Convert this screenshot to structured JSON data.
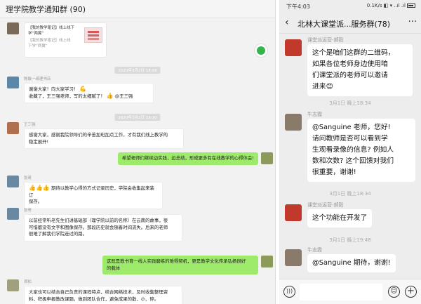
{
  "left": {
    "title": "理学院教学通知群 (90)",
    "card": {
      "line1": "【我的教学笔记】线上线下",
      "line2": "学“两翼”",
      "line3": "【我的教学笔记】线上线",
      "line4": "下学“两翼”"
    },
    "messages": [
      {
        "name": "陈敏一纸理书店",
        "time": "2020年3月2日 18:58",
        "lines": [
          "谢谢大家！向大家学习！",
          "收藏了，王三强老师，写的太细腻了！",
          "@王三强"
        ]
      },
      {
        "name": "王三强",
        "time": "2020年3月2日 19:10",
        "lines": [
          "感谢大家，感谢我院领导们的辛苦加班加点工作，才有我们线上教学的",
          "稳定展开!"
        ]
      },
      {
        "self": true,
        "lines": [
          "希望老师们继续边实践，边总结，形成更多有在线教学的心得体会!"
        ]
      },
      {
        "name": "张哥",
        "lines": [
          "期待以教学心得的方式记录历史，学院会收集起来装订",
          "保存。"
        ]
      },
      {
        "name": "张哥",
        "lines": [
          "以前经常听老先生们讲基础部（理学院以前的名称）在云南的故事，很",
          "可惜都没有文字和图像保存。那段历史就会随着时间流失。后来的老师",
          "很难了解我们学院走过的路。"
        ]
      },
      {
        "self": true,
        "lines": [
          "这既是教书育一线人实践磨练的难得契机，更是教学文化传承弘扬很好",
          "的载体"
        ]
      },
      {
        "name": "郑松",
        "lines": [
          "大家也可以结合自己负责的课程特点，结合网络技术，及时收集整理资",
          "料，积极申报教改课题。做到团队合作，避免成果的散、小、碎。"
        ]
      }
    ]
  },
  "phone": {
    "status": {
      "time": "下午4:03",
      "network": "0.1K/s ◧ ▾ ..ıl .ıl"
    },
    "title": "北林大课堂派...服务群(78)",
    "messages": [
      {
        "name": "课堂派运营-郝毅",
        "text_lines": [
          "这个是咱们这群的二维码，",
          "如果各位老师身边使用咱",
          "们课堂派的老师可以邀请",
          "进来😊"
        ]
      },
      {
        "time": "3月1日 晚上18:34"
      },
      {
        "name": "牛志霞",
        "text_lines": [
          "@Sanguine 老师，您好!",
          "请问教师是否可以看到学",
          "生观看录像的信息? 例如人",
          "数和次数? 这个回馈对我们",
          "很重要，谢谢!"
        ]
      },
      {
        "time": "3月1日 晚上18:34"
      },
      {
        "name": "课堂派运营-郝毅",
        "text_lines": [
          "这个功能在开发了"
        ]
      },
      {
        "time": "3月1日 晚上19:48"
      },
      {
        "name": "牛志霞",
        "text_lines": [
          "@Sanguine 期待，谢谢!"
        ]
      }
    ]
  },
  "icons": {
    "back": "back-arrow-icon",
    "more": "more-dots-icon",
    "voice": "voice-icon",
    "emoji": "emoji-icon",
    "plus": "plus-icon"
  },
  "colors": {
    "self_bubble": "#9eea6a",
    "wechat_green": "#35b44a"
  }
}
